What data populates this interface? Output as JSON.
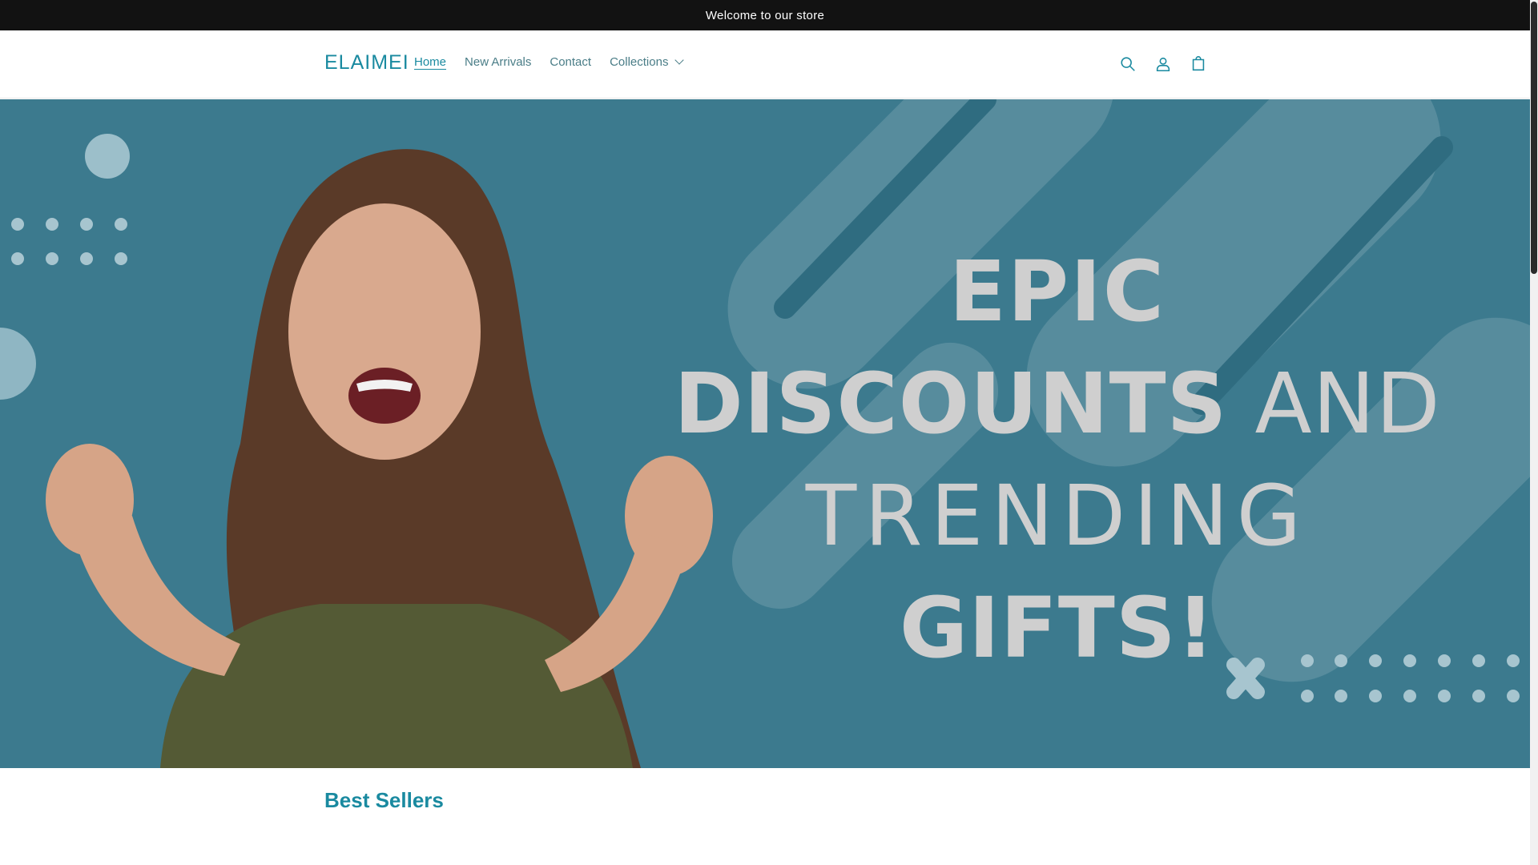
{
  "announcement": {
    "text": "Welcome to our store"
  },
  "header": {
    "logo": "ELAIMEI",
    "nav": [
      {
        "label": "Home",
        "active": true
      },
      {
        "label": "New Arrivals",
        "active": false
      },
      {
        "label": "Contact",
        "active": false
      },
      {
        "label": "Collections",
        "active": false,
        "has_dropdown": true
      }
    ],
    "icons": [
      "search-icon",
      "account-icon",
      "cart-icon"
    ]
  },
  "hero": {
    "line1": "EPIC",
    "line2_bold": "DISCOUNTS",
    "line2_light": "AND",
    "line3": "TRENDING",
    "line4": "GIFTS!",
    "background_color": "#3c7a8e",
    "text_color": "#cfcfcf"
  },
  "sections": {
    "best_sellers_title": "Best Sellers"
  },
  "colors": {
    "accent": "#1a8aa0",
    "announcement_bg": "#121212"
  }
}
